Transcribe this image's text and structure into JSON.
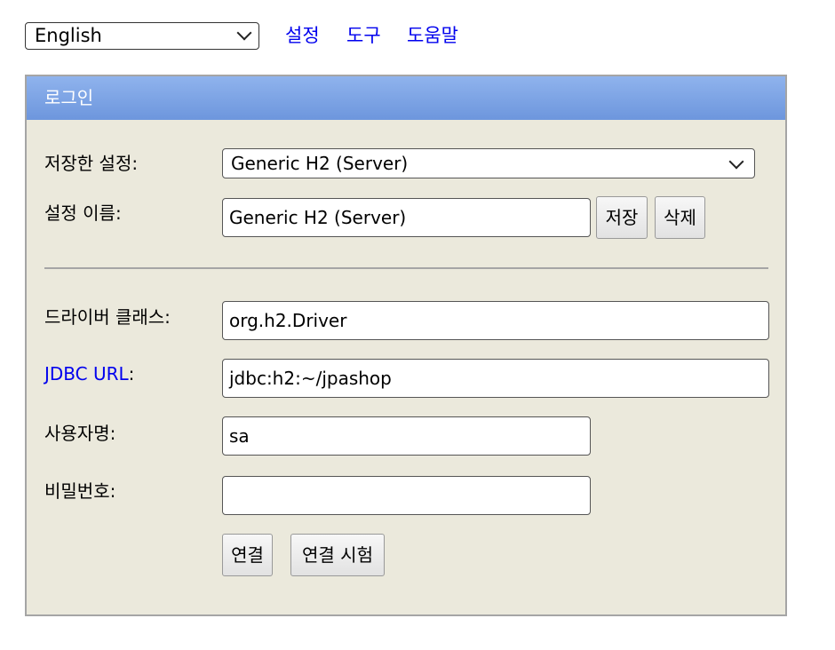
{
  "top": {
    "language": "English",
    "links": [
      "설정",
      "도구",
      "도움말"
    ]
  },
  "login": {
    "title": "로그인",
    "saved_settings_label": "저장한 설정:",
    "saved_settings_value": "Generic H2 (Server)",
    "setting_name_label": "설정 이름:",
    "setting_name_value": "Generic H2 (Server)",
    "save_button": "저장",
    "delete_button": "삭제",
    "driver_class_label": "드라이버 클래스:",
    "driver_class_value": "org.h2.Driver",
    "jdbc_url_label": "JDBC URL",
    "jdbc_url_colon": ":",
    "jdbc_url_value": "jdbc:h2:~/jpashop",
    "username_label": "사용자명:",
    "username_value": "sa",
    "password_label": "비밀번호:",
    "password_value": "",
    "connect_button": "연결",
    "test_connection_button": "연결 시험"
  }
}
